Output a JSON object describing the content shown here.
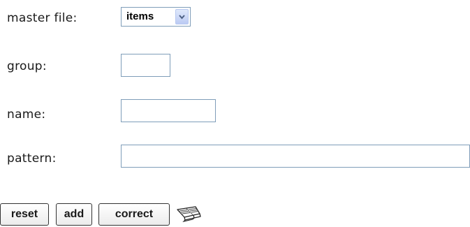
{
  "form": {
    "master_file": {
      "label": "master file:",
      "value": "items"
    },
    "group": {
      "label": "group:",
      "value": ""
    },
    "name": {
      "label": "name:",
      "value": ""
    },
    "pattern": {
      "label": "pattern:",
      "value": ""
    }
  },
  "buttons": {
    "reset": "reset",
    "add": "add",
    "correct": "correct"
  },
  "icons": {
    "help": "book-icon",
    "dropdown": "chevron-down-icon"
  },
  "colors": {
    "input_border": "#7f9db9",
    "dropdown_arrow": "#4d6185"
  }
}
